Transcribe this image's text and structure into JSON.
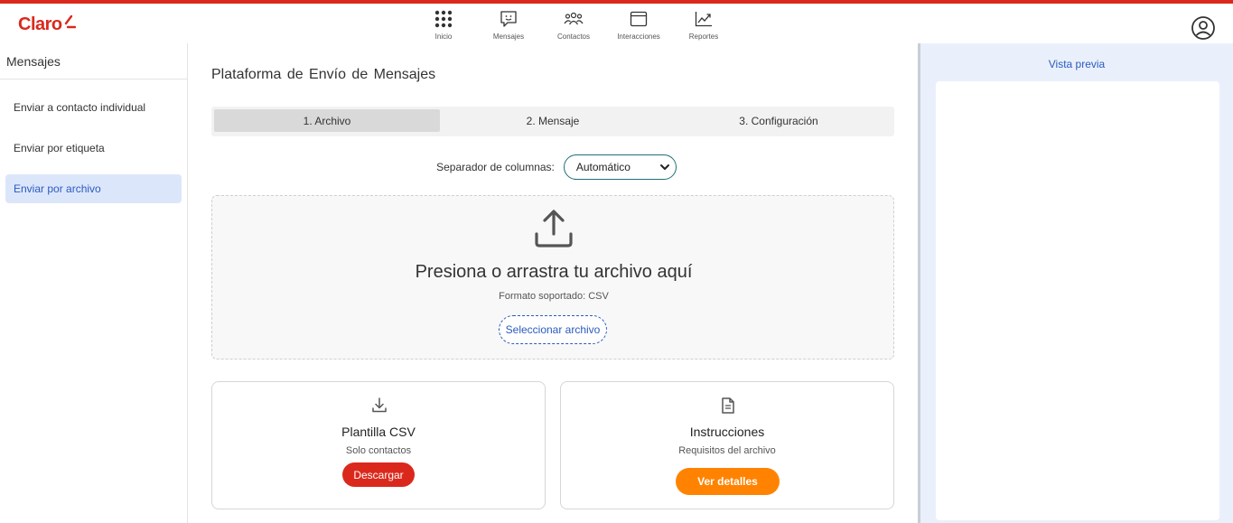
{
  "brand": {
    "name": "Claro",
    "accent": "#da291c"
  },
  "topnav": {
    "items": [
      {
        "label": "Inicio",
        "icon": "grid-icon"
      },
      {
        "label": "Mensajes",
        "icon": "message-icon"
      },
      {
        "label": "Contactos",
        "icon": "contacts-icon"
      },
      {
        "label": "Interacciones",
        "icon": "window-icon"
      },
      {
        "label": "Reportes",
        "icon": "chart-icon"
      }
    ],
    "account_icon": "user-circle-icon"
  },
  "sidebar": {
    "title": "Mensajes",
    "items": [
      {
        "label": "Enviar a contacto individual",
        "active": false
      },
      {
        "label": "Enviar por etiqueta",
        "active": false
      },
      {
        "label": "Enviar por archivo",
        "active": true
      }
    ]
  },
  "main": {
    "title": "Plataforma de Envío de Mensajes",
    "steps": [
      "1. Archivo",
      "2. Mensaje",
      "3. Configuración"
    ],
    "active_step": 0,
    "separator": {
      "label": "Separador de columnas:",
      "value": "Automático"
    },
    "dropzone": {
      "icon": "upload-icon",
      "title": "Presiona o arrastra tu archivo aquí",
      "subtitle": "Formato soportado: CSV",
      "button": "Seleccionar archivo"
    },
    "cards": [
      {
        "icon": "download-icon",
        "title": "Plantilla CSV",
        "subtitle": "Solo contactos",
        "button": "Descargar",
        "button_color": "#da291c"
      },
      {
        "icon": "document-icon",
        "title": "Instrucciones",
        "subtitle": "Requisitos del archivo",
        "button": "Ver detalles",
        "button_color": "#ff8300"
      }
    ]
  },
  "preview": {
    "title": "Vista previa"
  },
  "colors": {
    "link_blue": "#2a5bbf",
    "preview_bg": "#eaf0fb",
    "orange": "#ff8300"
  }
}
